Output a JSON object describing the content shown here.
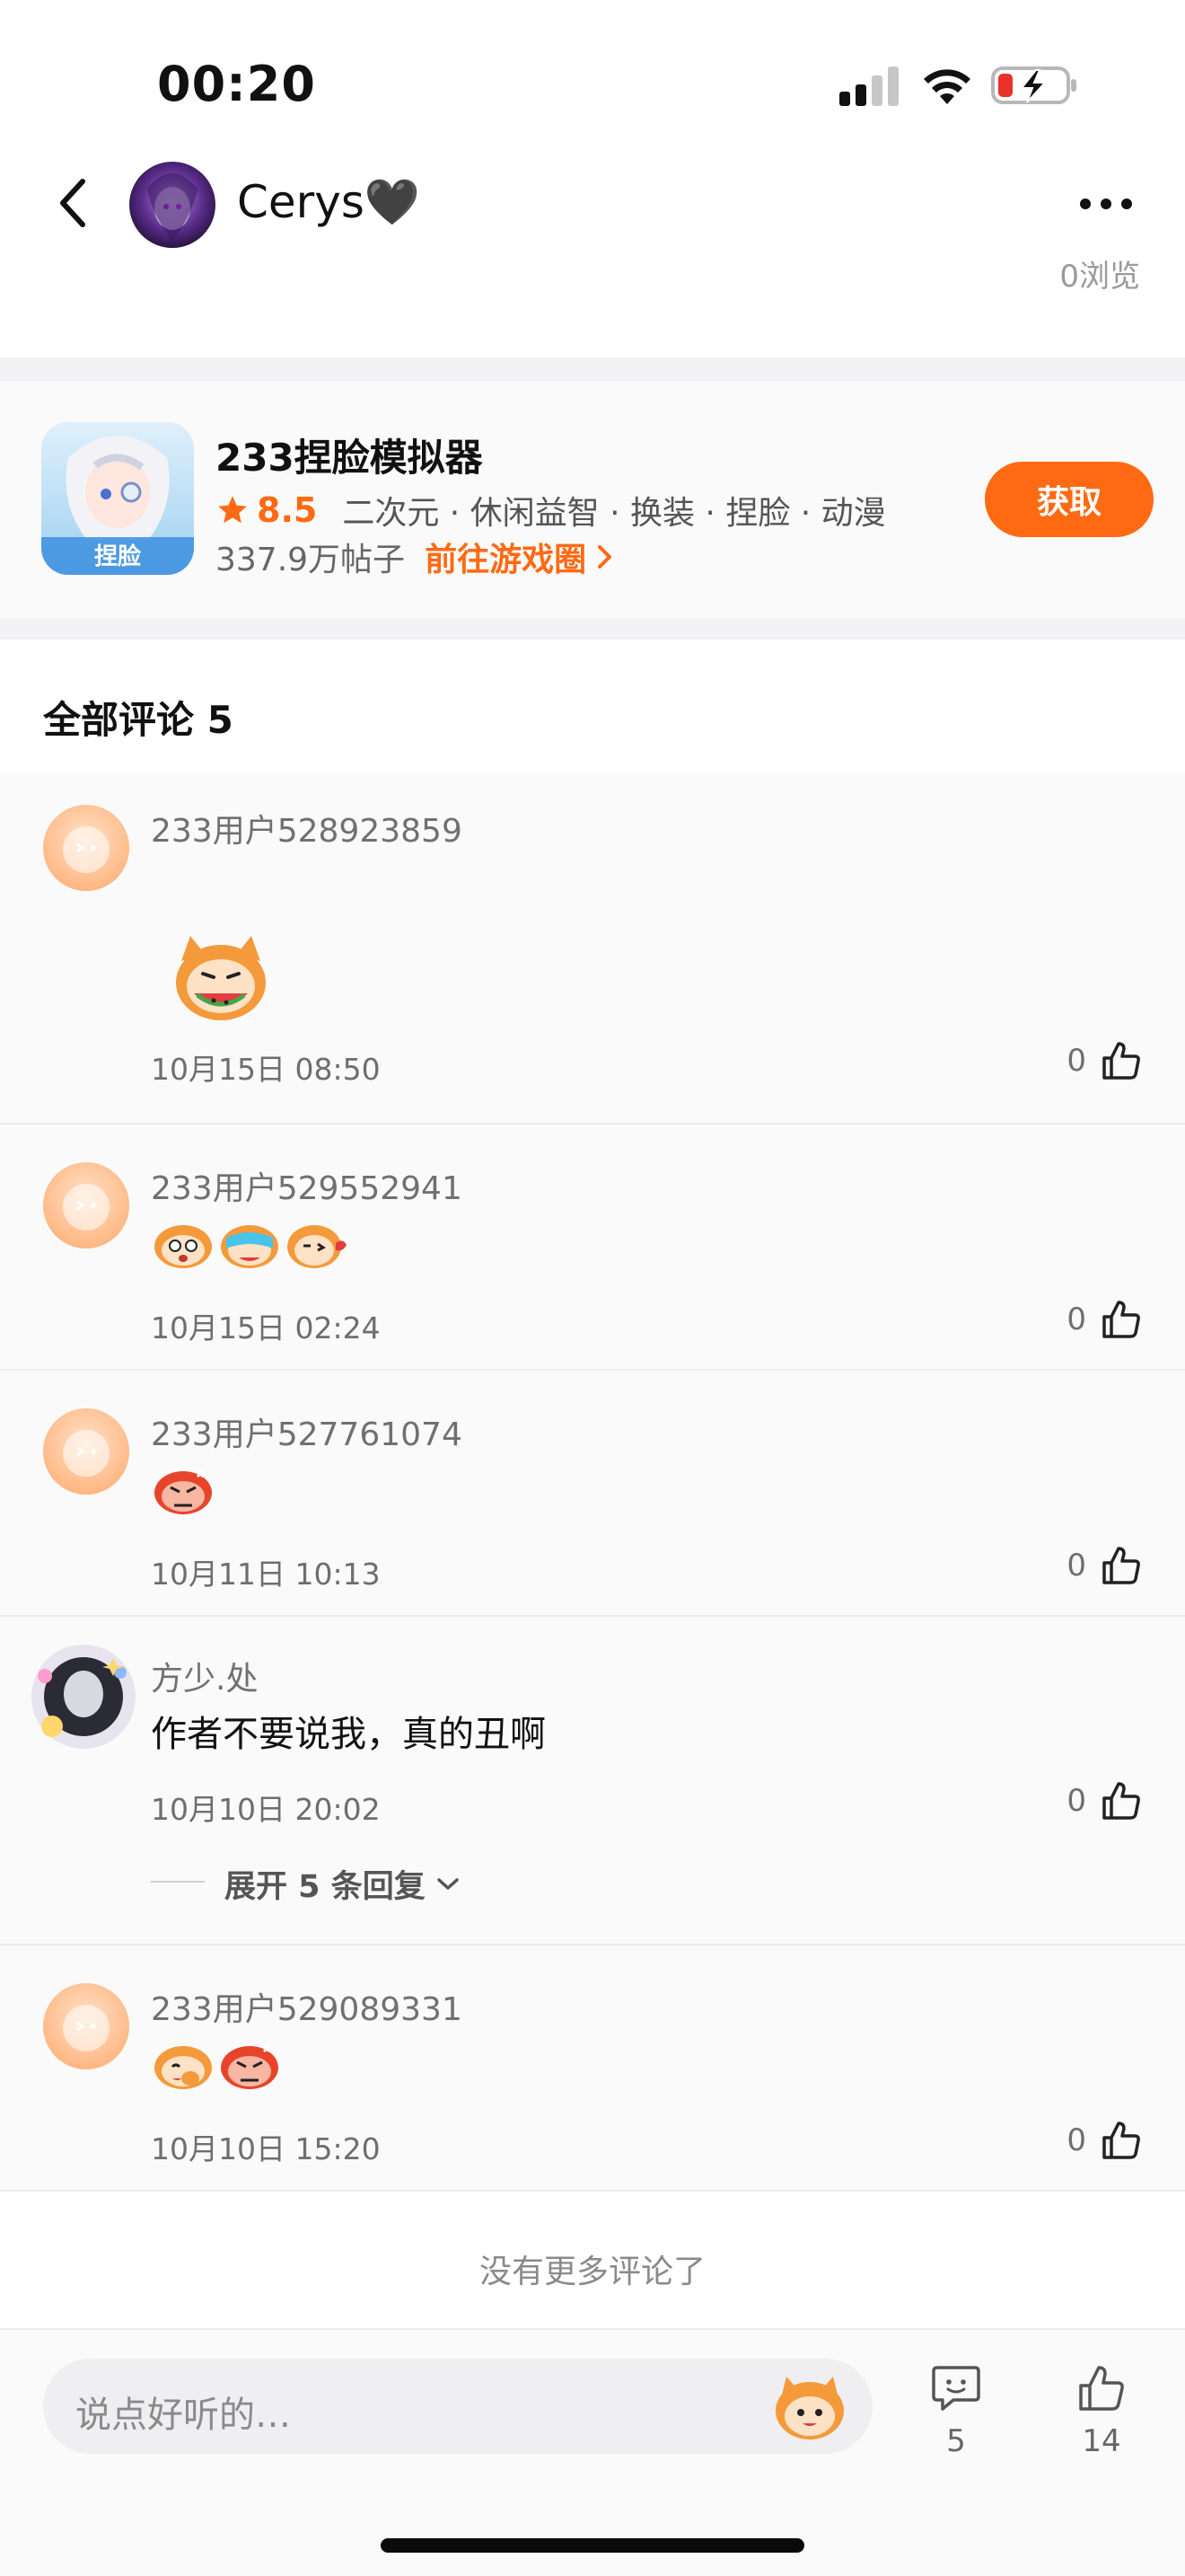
{
  "status_bar": {
    "time": "00:20"
  },
  "header": {
    "author_name": "Cerys🖤"
  },
  "post": {
    "views": "0浏览"
  },
  "game_card": {
    "title": "233捏脸模拟器",
    "rating": "8.5",
    "tags": "二次元 · 休闲益智 · 换装 · 捏脸 · 动漫",
    "posts_count": "337.9万帖子",
    "goto_label": "前往游戏圈",
    "get_label": "获取",
    "accent_color": "#ff6a13"
  },
  "comments_section": {
    "title": "全部评论 5",
    "comments": [
      {
        "user": "233用户528923859",
        "text": "",
        "emoji": "big-mascot-eating-icon",
        "time": "10月15日 08:50",
        "likes": "0"
      },
      {
        "user": "233用户529552941",
        "text": "",
        "emoji": "mascot-emoji-row-icon",
        "time": "10月15日 02:24",
        "likes": "0"
      },
      {
        "user": "233用户527761074",
        "text": "",
        "emoji": "angry-mascot-icon",
        "time": "10月11日 10:13",
        "likes": "0"
      },
      {
        "user": "方少.处",
        "text": "作者不要说我，真的丑啊",
        "emoji": "",
        "time": "10月10日 20:02",
        "likes": "0",
        "expand_label": "展开 5 条回复"
      },
      {
        "user": "233用户529089331",
        "text": "",
        "emoji": "mascot-emoji-row-icon",
        "time": "10月10日 15:20",
        "likes": "0"
      }
    ],
    "no_more": "没有更多评论了"
  },
  "bottom_bar": {
    "input_placeholder": "说点好听的…",
    "comment_count": "5",
    "like_count": "14"
  }
}
